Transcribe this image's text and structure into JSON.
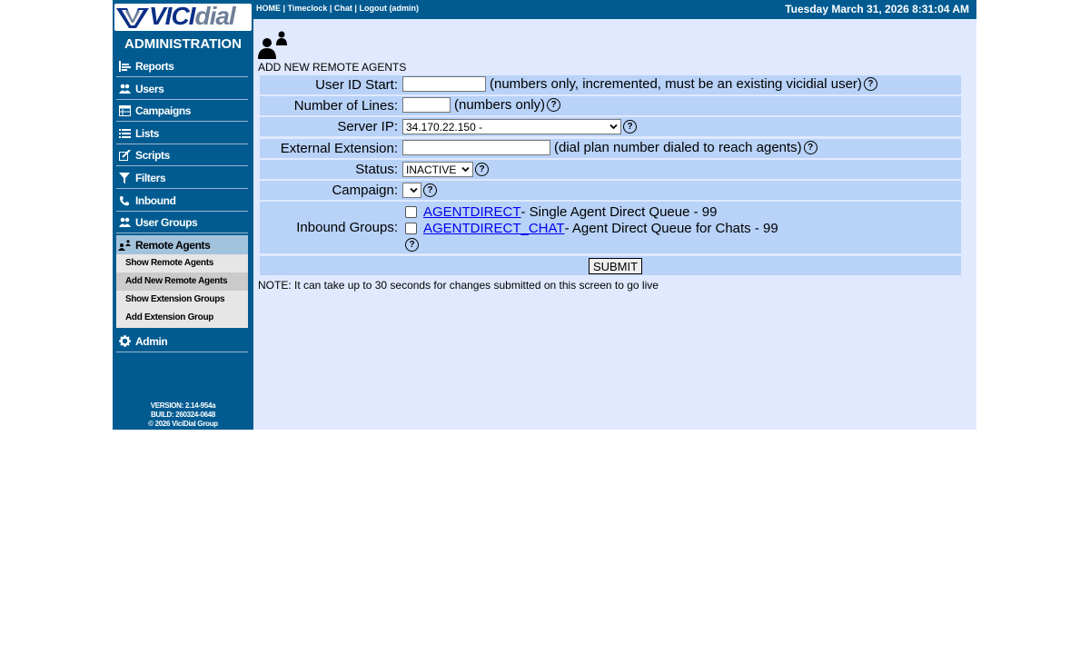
{
  "logo": {
    "vici": "VICI",
    "dial": "dial"
  },
  "sidebar": {
    "title": "ADMINISTRATION",
    "items": [
      {
        "label": "Reports",
        "icon": "reports-icon"
      },
      {
        "label": "Users",
        "icon": "users-icon"
      },
      {
        "label": "Campaigns",
        "icon": "campaigns-icon"
      },
      {
        "label": "Lists",
        "icon": "lists-icon"
      },
      {
        "label": "Scripts",
        "icon": "scripts-icon"
      },
      {
        "label": "Filters",
        "icon": "filter-icon"
      },
      {
        "label": "Inbound",
        "icon": "phone-icon"
      },
      {
        "label": "User Groups",
        "icon": "user-groups-icon"
      },
      {
        "label": "Remote Agents",
        "icon": "remote-agents-icon"
      },
      {
        "label": "Admin",
        "icon": "gear-icon"
      }
    ],
    "submenu": [
      "Show Remote Agents",
      "Add New Remote Agents",
      "Show Extension Groups",
      "Add Extension Group"
    ],
    "version": "VERSION: 2.14-954a",
    "build": "BUILD: 260324-0648",
    "copyright": "© 2026 ViciDial Group"
  },
  "topbar": {
    "home": "HOME",
    "timeclock": "Timeclock",
    "chat": "Chat",
    "logout": "Logout (admin)",
    "sep": " | ",
    "datetime": "Tuesday March 31, 2026 8:31:04 AM"
  },
  "page": {
    "heading": "ADD NEW REMOTE AGENTS",
    "help_glyph": "?",
    "fields": {
      "user_id_start": {
        "label": "User ID Start:",
        "value": "",
        "hint": "(numbers only, incremented, must be an existing vicidial user)"
      },
      "number_of_lines": {
        "label": "Number of Lines:",
        "value": "",
        "hint": "(numbers only)"
      },
      "server_ip": {
        "label": "Server IP:",
        "value": "34.170.22.150 -"
      },
      "external_extension": {
        "label": "External Extension:",
        "value": "",
        "hint": "(dial plan number dialed to reach agents)"
      },
      "status": {
        "label": "Status:",
        "value": "INACTIVE"
      },
      "campaign": {
        "label": "Campaign:",
        "value": ""
      },
      "inbound_groups": {
        "label": "Inbound Groups:",
        "groups": [
          {
            "id": "AGENTDIRECT",
            "desc": " - Single Agent Direct Queue - 99"
          },
          {
            "id": "AGENTDIRECT_CHAT",
            "desc": " - Agent Direct Queue for Chats - 99"
          }
        ]
      }
    },
    "submit": "SUBMIT",
    "note": "NOTE: It can take up to 30 seconds for changes submitted on this screen to go live"
  }
}
